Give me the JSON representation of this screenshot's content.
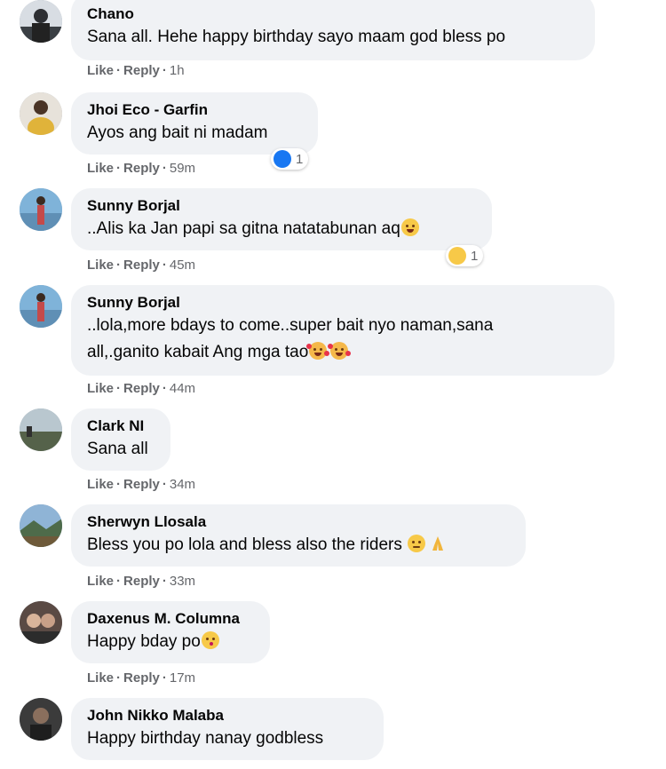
{
  "actions": {
    "like_label": "Like",
    "reply_label": "Reply",
    "separator": "·"
  },
  "comments": [
    {
      "author": "Chano",
      "text": "Sana all. Hehe happy birthday sayo maam god bless po",
      "time": "1h"
    },
    {
      "author": "Jhoi Eco - Garfin",
      "text": "Ayos ang bait ni madam",
      "time": "59m",
      "reaction": {
        "type": "like-icon",
        "count": "1"
      }
    },
    {
      "author": "Sunny Borjal",
      "text": "..Alis ka Jan papi sa gitna natatabunan aq",
      "time": "45m",
      "reaction": {
        "type": "haha-icon",
        "count": "1"
      }
    },
    {
      "author": "Sunny Borjal",
      "text_line1": "..lola,more bdays to come..super bait nyo naman,sana",
      "text_line2": "all,.ganito kabait Ang mga tao",
      "time": "44m"
    },
    {
      "author": "Clark NI",
      "text": "Sana all",
      "time": "34m"
    },
    {
      "author": "Sherwyn Llosala",
      "text": "Bless you po lola and bless also the riders",
      "time": "33m"
    },
    {
      "author": "Daxenus M. Columna",
      "text": "Happy bday po",
      "time": "17m"
    },
    {
      "author": "John Nikko Malaba",
      "text": "Happy birthday nanay godbless"
    }
  ],
  "colors": {
    "bubble": "#f0f2f5",
    "meta": "#65676b",
    "like": "#1877f2"
  }
}
